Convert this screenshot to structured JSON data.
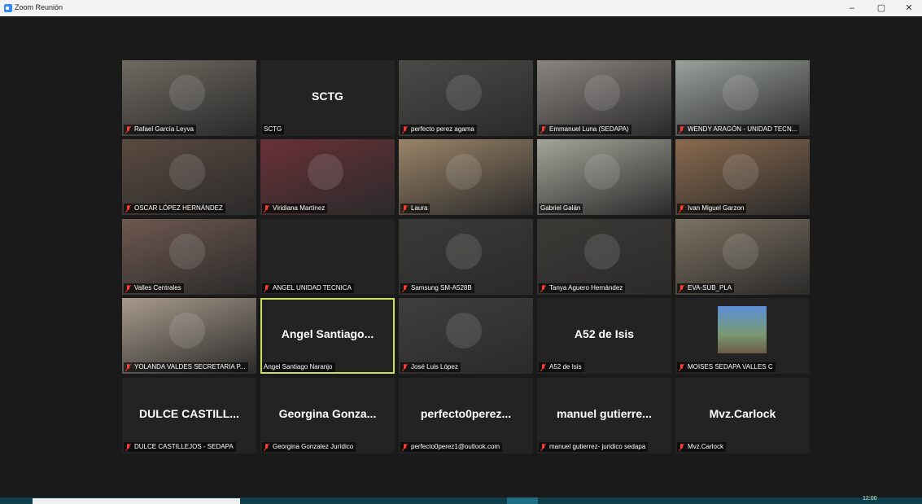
{
  "window": {
    "title": "Zoom Reunión",
    "minimize": "–",
    "maximize": "▢",
    "close": "✕"
  },
  "participants": [
    {
      "name": "Rafael García Leyva",
      "big": "",
      "muted": true,
      "bg": "#6f6a62"
    },
    {
      "name": "SCTG",
      "big": "SCTG",
      "muted": false,
      "bg": ""
    },
    {
      "name": "perfecto perez agama",
      "big": "",
      "muted": true,
      "bg": "#4a4a48"
    },
    {
      "name": "Emmanuel Luna (SEDAPA)",
      "big": "",
      "muted": true,
      "bg": "#8a8580"
    },
    {
      "name": "WENDY ARAGÓN - UNIDAD TECN...",
      "big": "",
      "muted": true,
      "bg": "#9aa19c"
    },
    {
      "name": "OSCAR LÓPEZ HERNÁNDEZ",
      "big": "",
      "muted": true,
      "bg": "#5a4a40"
    },
    {
      "name": "Viridiana Martínez",
      "big": "",
      "muted": true,
      "bg": "#6a3038"
    },
    {
      "name": "Laura",
      "big": "",
      "muted": true,
      "bg": "#9a8468"
    },
    {
      "name": "Gabriel Galán",
      "big": "",
      "muted": false,
      "bg": "#a4a49a"
    },
    {
      "name": "Ivan Miguel Garzon",
      "big": "",
      "muted": true,
      "bg": "#8a6a4e"
    },
    {
      "name": "Valles Centrales",
      "big": "",
      "muted": true,
      "bg": "#6e5850"
    },
    {
      "name": "ANGEL UNIDAD TECNICA",
      "big": "",
      "muted": true,
      "bg": ""
    },
    {
      "name": "Samsung SM-A528B",
      "big": "",
      "muted": true,
      "bg": "#3a3a38"
    },
    {
      "name": "Tanya Aguero Hernández",
      "big": "",
      "muted": true,
      "bg": "#3c3a36"
    },
    {
      "name": "EVA-SUB_PLA",
      "big": "",
      "muted": true,
      "bg": "#7c7262"
    },
    {
      "name": "YOLANDA VALDES SECRETARIA P...",
      "big": "",
      "muted": true,
      "bg": "#a89a8c"
    },
    {
      "name": "Angel Santiago Naranjo",
      "big": "Angel Santiago...",
      "muted": false,
      "bg": ""
    },
    {
      "name": "José Luis López",
      "big": "",
      "muted": true,
      "bg": "#3e3e3c"
    },
    {
      "name": "A52 de Isis",
      "big": "A52 de Isis",
      "muted": true,
      "bg": ""
    },
    {
      "name": "MOISES SEDAPA VALLES C",
      "big": "",
      "muted": true,
      "bg": ""
    },
    {
      "name": "DULCE CASTILLEJOS - SEDAPA",
      "big": "DULCE CASTILL...",
      "muted": true,
      "bg": ""
    },
    {
      "name": "Georgina Gonzalez Jurídico",
      "big": "Georgina Gonza...",
      "muted": true,
      "bg": ""
    },
    {
      "name": "perfecto0perez1@outlook.com",
      "big": "perfecto0perez...",
      "muted": true,
      "bg": ""
    },
    {
      "name": "manuel gutierrez- juridico sedapa",
      "big": "manuel gutierre...",
      "muted": true,
      "bg": ""
    },
    {
      "name": "Mvz.Carlock",
      "big": "Mvz.Carlock",
      "muted": true,
      "bg": ""
    }
  ],
  "taskbar": {
    "clock": "12:00"
  }
}
